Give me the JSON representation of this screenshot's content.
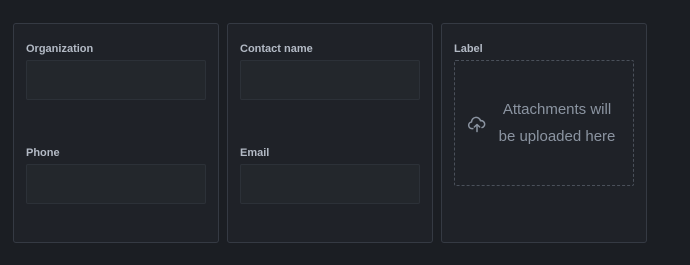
{
  "panels": [
    {
      "fields": [
        {
          "label": "Organization",
          "value": "",
          "placeholder": ""
        },
        {
          "label": "Phone",
          "value": "",
          "placeholder": ""
        }
      ]
    },
    {
      "fields": [
        {
          "label": "Contact name",
          "value": "",
          "placeholder": ""
        },
        {
          "label": "Email",
          "value": "",
          "placeholder": ""
        }
      ]
    },
    {
      "label": "Label",
      "dropzone": {
        "icon": "cloud-upload-icon",
        "line1": "Attachments will",
        "line2": "be uploaded here"
      }
    }
  ],
  "colors": {
    "background": "#1b1e23",
    "panel": "#1f2228",
    "panel_border": "#353a43",
    "field_bg": "#23272c",
    "label_text": "#b3bac5",
    "muted_text": "#8b94a1"
  }
}
